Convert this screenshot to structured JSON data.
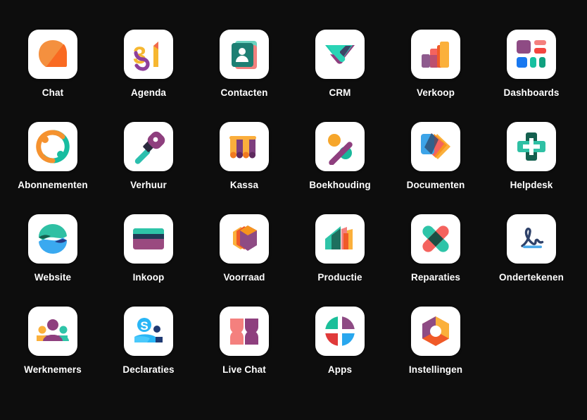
{
  "page": {
    "background_color": "#0d0d0d",
    "label_color": "#ffffff",
    "tile_color": "#ffffff",
    "title": "Odoo Apps Menu"
  },
  "apps": [
    {
      "label": "Chat",
      "icon": "chat-icon",
      "row": 1,
      "col": 1,
      "colors": [
        "#f4903f",
        "#f96a22"
      ]
    },
    {
      "label": "Agenda",
      "icon": "calendar-31-icon",
      "row": 1,
      "col": 2,
      "colors": [
        "#f6b731",
        "#8e3f9b"
      ]
    },
    {
      "label": "Contacten",
      "icon": "contacts-icon",
      "row": 1,
      "col": 3,
      "colors": [
        "#1d7f73",
        "#f2807e",
        "#2aa390"
      ]
    },
    {
      "label": "CRM",
      "icon": "crm-handshake-icon",
      "row": 1,
      "col": 4,
      "colors": [
        "#21c9ad",
        "#8e3f7e",
        "#3d4466"
      ]
    },
    {
      "label": "Verkoop",
      "icon": "sales-bars-icon",
      "row": 1,
      "col": 5,
      "colors": [
        "#8e5b8e",
        "#f05a28",
        "#fbb03b"
      ]
    },
    {
      "label": "Dashboards",
      "icon": "dashboards-icon",
      "row": 1,
      "col": 6,
      "colors": [
        "#8e4b84",
        "#f4635e",
        "#1878f0",
        "#16a085"
      ]
    },
    {
      "label": "Abonnementen",
      "icon": "subscriptions-icon",
      "row": 2,
      "col": 1,
      "colors": [
        "#f5922f",
        "#17bda0"
      ]
    },
    {
      "label": "Verhuur",
      "icon": "rental-key-icon",
      "row": 2,
      "col": 2,
      "colors": [
        "#8e3f7e",
        "#2bbfae"
      ]
    },
    {
      "label": "Kassa",
      "icon": "pos-awning-icon",
      "row": 2,
      "col": 3,
      "colors": [
        "#fbae3c",
        "#7e3f7e"
      ]
    },
    {
      "label": "Boekhouding",
      "icon": "accounting-icon",
      "row": 2,
      "col": 4,
      "colors": [
        "#f6a62b",
        "#19b79b",
        "#8e3f7e"
      ]
    },
    {
      "label": "Documenten",
      "icon": "documents-icon",
      "row": 2,
      "col": 5,
      "colors": [
        "#3da4e8",
        "#f4635e",
        "#f7941e",
        "#fbb03b"
      ]
    },
    {
      "label": "Helpdesk",
      "icon": "helpdesk-cross-icon",
      "row": 2,
      "col": 6,
      "colors": [
        "#2fc0a4",
        "#14604f"
      ]
    },
    {
      "label": "Website",
      "icon": "website-icon",
      "row": 3,
      "col": 1,
      "colors": [
        "#2fc0a4",
        "#3aa9f0",
        "#16604f",
        "#273a86"
      ]
    },
    {
      "label": "Inkoop",
      "icon": "purchase-card-icon",
      "row": 3,
      "col": 2,
      "colors": [
        "#2ec4a8",
        "#203a56",
        "#9a4a80"
      ]
    },
    {
      "label": "Voorraad",
      "icon": "inventory-box-icon",
      "row": 3,
      "col": 3,
      "colors": [
        "#f7941e",
        "#f05a28",
        "#8e4b84"
      ]
    },
    {
      "label": "Productie",
      "icon": "manufacturing-icon",
      "row": 3,
      "col": 4,
      "colors": [
        "#2ec4a8",
        "#1d6f5e",
        "#f4635e",
        "#fbb03b"
      ]
    },
    {
      "label": "Reparaties",
      "icon": "repairs-cross-icon",
      "row": 3,
      "col": 5,
      "colors": [
        "#2ec4a8",
        "#f4635e",
        "#1c4f44"
      ]
    },
    {
      "label": "Ondertekenen",
      "icon": "sign-signature-icon",
      "row": 3,
      "col": 6,
      "colors": [
        "#2e4169",
        "#4aa8ea"
      ]
    },
    {
      "label": "Werknemers",
      "icon": "employees-icon",
      "row": 4,
      "col": 1,
      "colors": [
        "#8e3f7e",
        "#fbb03b",
        "#2ec4a8"
      ]
    },
    {
      "label": "Declaraties",
      "icon": "expenses-icon",
      "row": 4,
      "col": 2,
      "colors": [
        "#3aa9f0",
        "#1f3a73",
        "#29b6f6"
      ]
    },
    {
      "label": "Live Chat",
      "icon": "live-chat-icon",
      "row": 4,
      "col": 3,
      "colors": [
        "#f4807e",
        "#8e3f7e"
      ]
    },
    {
      "label": "Apps",
      "icon": "apps-circle-icon",
      "row": 4,
      "col": 4,
      "colors": [
        "#1bbf9a",
        "#8e4b84",
        "#e03a3a",
        "#29a7ee"
      ]
    },
    {
      "label": "Instellingen",
      "icon": "settings-gear-icon",
      "row": 4,
      "col": 5,
      "colors": [
        "#8e4b84",
        "#fbb03b",
        "#f05a28"
      ]
    }
  ]
}
